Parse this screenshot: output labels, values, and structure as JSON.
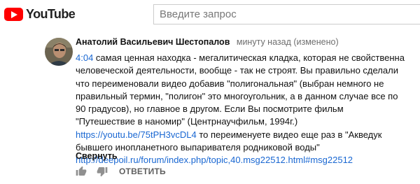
{
  "header": {
    "logo_text": "YouTube",
    "search_placeholder": "Введите запрос"
  },
  "comment": {
    "author": "Анатолий Васильевич Шестопалов",
    "meta": "минуту назад (изменено)",
    "timestamp_link": "4:04",
    "text_part1": " самая ценная находка - мегалитическая кладка, которая не свойственна человеческой деятельности, вообще - так не строят. Вы правильно сделали что переименовали видео добавив \"полигональная\" (выбран немного не правильный термин, \"полигон\" это многоугольник, а в данном случае все по 90 градусов), но главное в другом. Если Вы посмотрите фильм \"Путешествие в наномир\" (Центрнаучфильм, 1994г.) ",
    "link1": "https://youtu.be/75tPH3vcDL4",
    "text_part2": " то переименуете видео еще раз в \"Акведук бывшего инопланетного выпаривателя родниковой воды\" ",
    "link2": "http://deepoil.ru/forum/index.php/topic,40.msg22512.html#msg22512",
    "collapse_label": "Свернуть",
    "reply_label": "ОТВЕТИТЬ"
  },
  "colors": {
    "brand_red": "#ff0000",
    "link_blue": "#1967d2",
    "meta_gray": "#6f6f6f",
    "icon_gray": "#909090"
  },
  "icons": [
    "youtube-logo-icon",
    "like-icon",
    "dislike-icon"
  ]
}
